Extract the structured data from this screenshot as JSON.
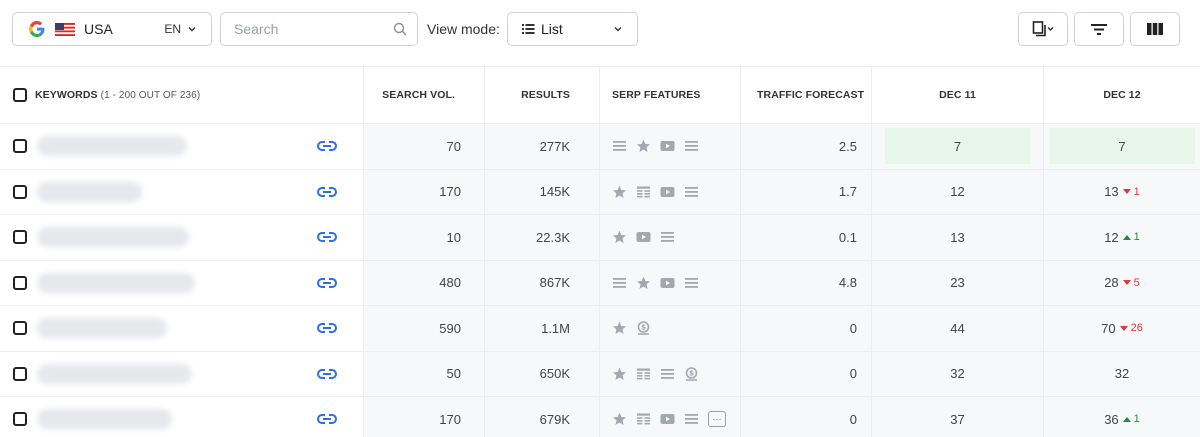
{
  "toolbar": {
    "country": "USA",
    "language": "EN",
    "search_placeholder": "Search",
    "view_mode_label": "View mode:",
    "view_mode_value": "List"
  },
  "table": {
    "headers": {
      "keywords": "KEYWORDS",
      "keywords_count": "(1 - 200 OUT OF 236)",
      "search_vol": "SEARCH VOL.",
      "results": "RESULTS",
      "serp_features": "SERP FEATURES",
      "traffic_forecast": "TRAFFIC FORECAST",
      "dec11": "DEC 11",
      "dec12": "DEC 12"
    },
    "rows": [
      {
        "search_vol": "70",
        "results": "277K",
        "serp": [
          "list",
          "star",
          "video",
          "list"
        ],
        "traffic": "2.5",
        "dec11": "7",
        "dec12": "7",
        "delta": "",
        "dir": "",
        "highlight": true
      },
      {
        "search_vol": "170",
        "results": "145K",
        "serp": [
          "star",
          "table",
          "video",
          "list"
        ],
        "traffic": "1.7",
        "dec11": "12",
        "dec12": "13",
        "delta": "1",
        "dir": "down",
        "highlight": false
      },
      {
        "search_vol": "10",
        "results": "22.3K",
        "serp": [
          "star",
          "video",
          "list"
        ],
        "traffic": "0.1",
        "dec11": "13",
        "dec12": "12",
        "delta": "1",
        "dir": "up",
        "highlight": false
      },
      {
        "search_vol": "480",
        "results": "867K",
        "serp": [
          "list",
          "star",
          "video",
          "list"
        ],
        "traffic": "4.8",
        "dec11": "23",
        "dec12": "28",
        "delta": "5",
        "dir": "down",
        "highlight": false
      },
      {
        "search_vol": "590",
        "results": "1.1M",
        "serp": [
          "star",
          "coin"
        ],
        "traffic": "0",
        "dec11": "44",
        "dec12": "70",
        "delta": "26",
        "dir": "down",
        "highlight": false
      },
      {
        "search_vol": "50",
        "results": "650K",
        "serp": [
          "star",
          "table",
          "list",
          "coin"
        ],
        "traffic": "0",
        "dec11": "32",
        "dec12": "32",
        "delta": "",
        "dir": "",
        "highlight": false
      },
      {
        "search_vol": "170",
        "results": "679K",
        "serp": [
          "star",
          "table",
          "video",
          "list",
          "more"
        ],
        "traffic": "0",
        "dec11": "37",
        "dec12": "36",
        "delta": "1",
        "dir": "up",
        "highlight": false
      }
    ]
  },
  "colors": {
    "link": "#2f6fe0",
    "highlight": "#e6f7ea",
    "down": "#e03737",
    "up": "#1f8a3b",
    "serp_icon": "#a2a7b0"
  }
}
